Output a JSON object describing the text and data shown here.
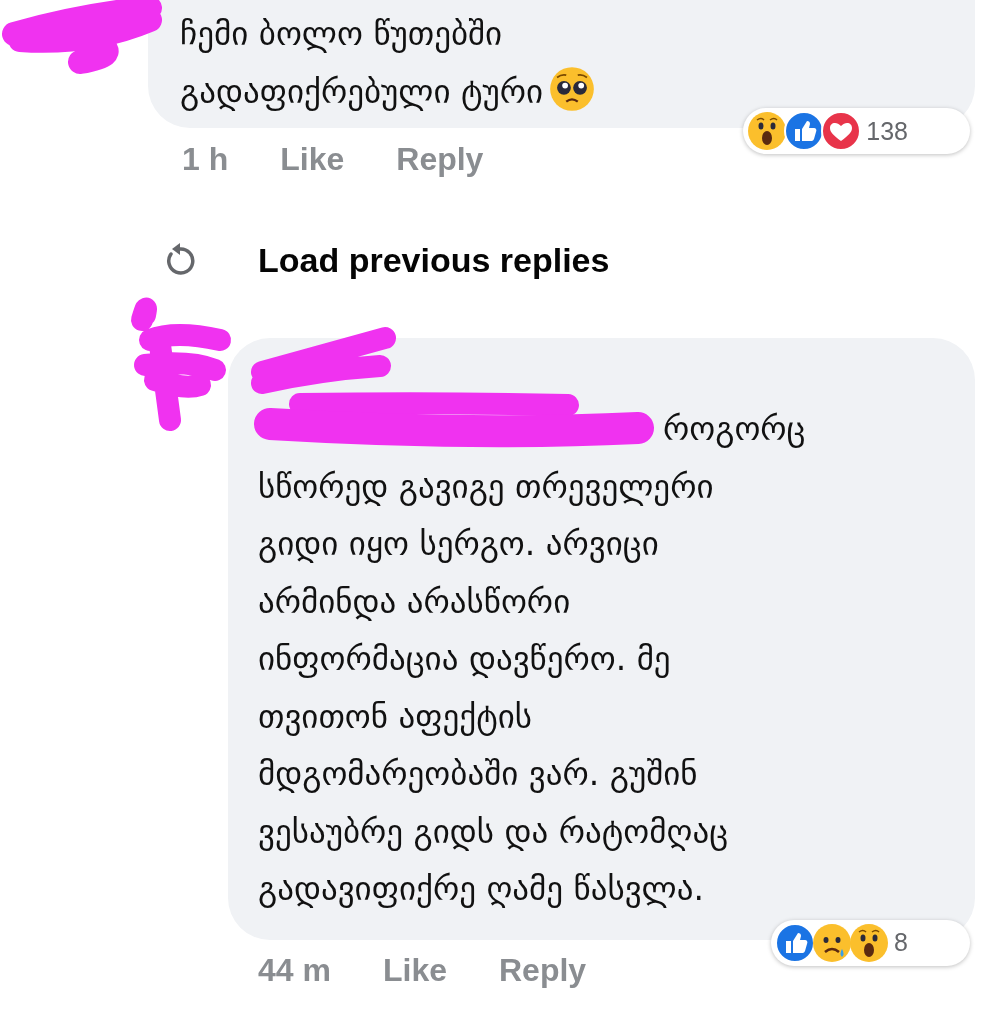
{
  "comments": [
    {
      "text": "ჩემი ბოლო წუთებში\nგადაფიქრებული ტური",
      "emoji": {
        "kind": "pleading"
      },
      "time": "1 h",
      "like": "Like",
      "reply": "Reply",
      "reactions": [
        {
          "kind": "wow"
        },
        {
          "kind": "like"
        },
        {
          "kind": "love"
        }
      ],
      "reaction_count": "138"
    },
    {
      "lead_fragment": "როგორც",
      "text": "სწორედ გავიგე თრეველერი\nგიდი იყო სერგო. არვიცი\nარმინდა არასწორი\nინფორმაცია დავწერო. მე\nთვითონ აფექტის\nმდგომარეობაში ვარ. გუშინ\nვესაუბრე გიდს და რატომღაც\nგადავიფიქრე ღამე წასვლა.",
      "time": "44 m",
      "like": "Like",
      "reply": "Reply",
      "reactions": [
        {
          "kind": "like"
        },
        {
          "kind": "sad"
        },
        {
          "kind": "wow"
        }
      ],
      "reaction_count": "8"
    }
  ],
  "load_previous": {
    "label": "Load previous replies"
  }
}
